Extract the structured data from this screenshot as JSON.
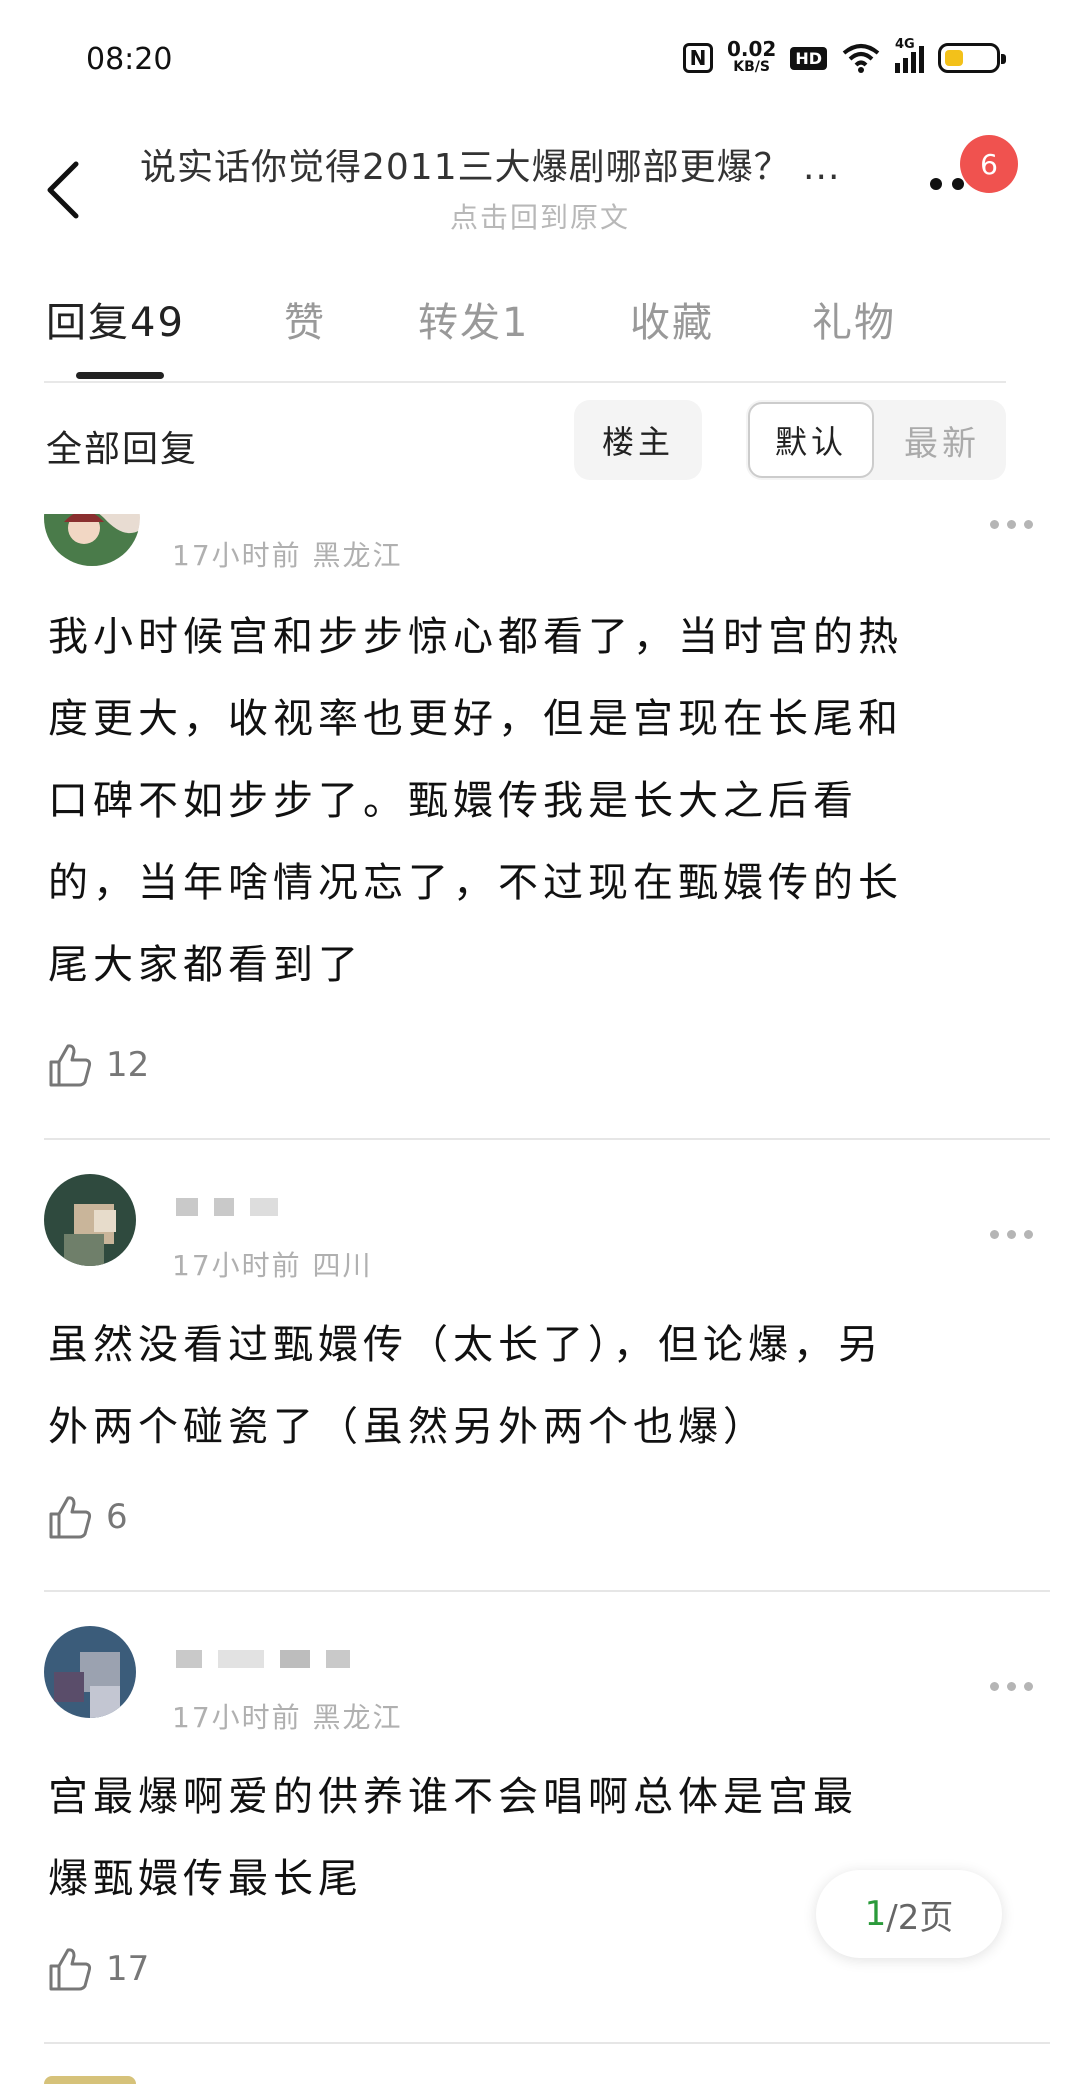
{
  "status_bar": {
    "time": "08:20",
    "nfc": "N",
    "speed_value": "0.02",
    "speed_unit": "KB/S",
    "hd": "HD",
    "network": "4G"
  },
  "header": {
    "title": "说实话你觉得2011三大爆剧哪部更爆？ ...",
    "subtitle": "点击回到原文",
    "notification_count": "6"
  },
  "tabs": [
    {
      "label": "回复49",
      "active": true
    },
    {
      "label": "赞",
      "active": false
    },
    {
      "label": "转发1",
      "active": false
    },
    {
      "label": "收藏",
      "active": false
    },
    {
      "label": "礼物",
      "active": false
    }
  ],
  "filter": {
    "all_replies": "全部回复",
    "louzhu": "楼主",
    "sort_default": "默认",
    "sort_newest": "最新"
  },
  "comments": [
    {
      "meta": "17小时前 黑龙江",
      "lines": [
        "我小时候宫和步步惊心都看了，当时宫的热",
        "度更大，收视率也更好，但是宫现在长尾和",
        "口碑不如步步了。甄嬛传我是长大之后看",
        "的，当年啥情况忘了，不过现在甄嬛传的长",
        "尾大家都看到了"
      ],
      "likes": "12"
    },
    {
      "meta": "17小时前 四川",
      "lines": [
        "虽然没看过甄嬛传（太长了），但论爆，另",
        "外两个碰瓷了（虽然另外两个也爆）"
      ],
      "likes": "6"
    },
    {
      "meta": "17小时前 黑龙江",
      "lines": [
        "宫最爆啊爱的供养谁不会唱啊总体是宫最",
        "爆甄嬛传最长尾"
      ],
      "likes": "17"
    }
  ],
  "pager": {
    "current": "1",
    "total": "/2页"
  },
  "colors": {
    "badge": "#f0524f",
    "pager_current": "#2a9a3a",
    "battery": "#f3c11a"
  },
  "icons": [
    "back-arrow-icon",
    "more-icon",
    "thumbs-up-icon",
    "nfc-icon",
    "wifi-icon",
    "signal-icon",
    "battery-icon"
  ]
}
